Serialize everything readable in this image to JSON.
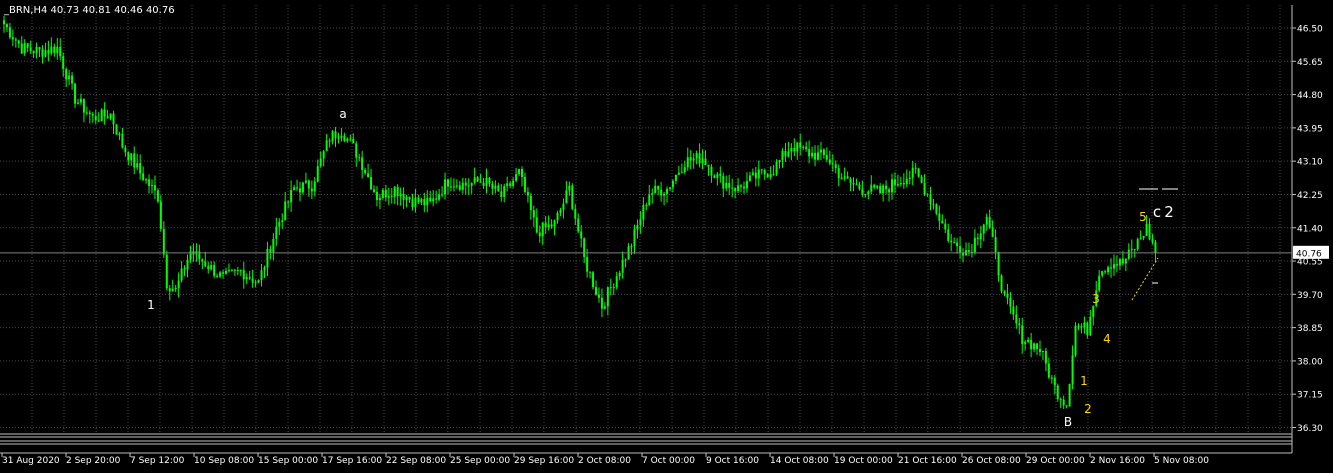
{
  "header": {
    "symbol": "_BRN,H4",
    "ohlc": "40.73 40.81 40.46 40.76"
  },
  "colors": {
    "background": "#000000",
    "grid": "#4b4b4b",
    "frame": "#c0c0c0",
    "bull": "#00ff00",
    "bear": "#00ff00",
    "text": "#ffffff",
    "wave_white": "#ffffff",
    "wave_yellow": "#ffd700",
    "price_tag_bg": "#ffffff",
    "price_tag_text": "#000000"
  },
  "chart_data": {
    "type": "candlestick",
    "timeframe": "H4",
    "ylim": [
      36.0,
      46.9
    ],
    "yticks": [
      "46.50",
      "45.65",
      "44.80",
      "43.95",
      "43.10",
      "42.25",
      "41.40",
      "40.55",
      "39.70",
      "38.85",
      "38.00",
      "37.15",
      "36.30"
    ],
    "xticks": [
      "31 Aug 2020",
      "2 Sep 20:00",
      "7 Sep 12:00",
      "10 Sep 08:00",
      "15 Sep 00:00",
      "17 Sep 16:00",
      "22 Sep 08:00",
      "25 Sep 00:00",
      "29 Sep 16:00",
      "2 Oct 08:00",
      "7 Oct 00:00",
      "9 Oct 16:00",
      "14 Oct 08:00",
      "19 Oct 00:00",
      "21 Oct 16:00",
      "26 Oct 08:00",
      "29 Oct 00:00",
      "2 Nov 16:00",
      "5 Nov 08:00"
    ],
    "current_price": "40.76",
    "close_path": [
      [
        0,
        46.6
      ],
      [
        6,
        46.0
      ],
      [
        12,
        45.9
      ],
      [
        18,
        46.0
      ],
      [
        24,
        44.7
      ],
      [
        30,
        44.2
      ],
      [
        36,
        44.3
      ],
      [
        40,
        43.5
      ],
      [
        46,
        42.8
      ],
      [
        52,
        42.2
      ],
      [
        55,
        40.0
      ],
      [
        58,
        39.8
      ],
      [
        63,
        40.8
      ],
      [
        68,
        40.5
      ],
      [
        74,
        40.1
      ],
      [
        80,
        40.3
      ],
      [
        86,
        40.0
      ],
      [
        92,
        41.4
      ],
      [
        98,
        42.4
      ],
      [
        104,
        42.5
      ],
      [
        110,
        43.7
      ],
      [
        114,
        43.9
      ],
      [
        120,
        43.2
      ],
      [
        126,
        42.2
      ],
      [
        132,
        42.4
      ],
      [
        138,
        42.1
      ],
      [
        144,
        42.0
      ],
      [
        150,
        42.6
      ],
      [
        156,
        42.5
      ],
      [
        162,
        42.6
      ],
      [
        168,
        42.2
      ],
      [
        174,
        42.8
      ],
      [
        180,
        41.3
      ],
      [
        186,
        41.5
      ],
      [
        191,
        42.4
      ],
      [
        196,
        40.6
      ],
      [
        202,
        39.4
      ],
      [
        207,
        40.2
      ],
      [
        212,
        41.0
      ],
      [
        218,
        42.3
      ],
      [
        224,
        42.4
      ],
      [
        230,
        43.1
      ],
      [
        236,
        43.2
      ],
      [
        242,
        42.6
      ],
      [
        248,
        42.4
      ],
      [
        254,
        42.7
      ],
      [
        260,
        42.9
      ],
      [
        266,
        43.5
      ],
      [
        272,
        43.3
      ],
      [
        278,
        43.2
      ],
      [
        284,
        42.6
      ],
      [
        290,
        42.4
      ],
      [
        296,
        42.3
      ],
      [
        302,
        42.6
      ],
      [
        308,
        42.8
      ],
      [
        314,
        42.0
      ],
      [
        320,
        41.0
      ],
      [
        326,
        40.8
      ],
      [
        332,
        41.7
      ],
      [
        338,
        39.6
      ],
      [
        344,
        38.6
      ],
      [
        350,
        38.3
      ],
      [
        355,
        37.3
      ],
      [
        359,
        36.9
      ],
      [
        362,
        38.9
      ],
      [
        366,
        38.8
      ],
      [
        370,
        40.3
      ],
      [
        374,
        40.5
      ],
      [
        378,
        40.5
      ],
      [
        382,
        40.9
      ],
      [
        386,
        41.4
      ],
      [
        389,
        40.8
      ]
    ],
    "wave_labels": [
      {
        "text": "1",
        "series": "white"
      },
      {
        "text": "a",
        "series": "white"
      },
      {
        "text": "B",
        "series": "white"
      },
      {
        "text": "1",
        "series": "yellow"
      },
      {
        "text": "2",
        "series": "yellow"
      },
      {
        "text": "3",
        "series": "yellow"
      },
      {
        "text": "4",
        "series": "yellow"
      },
      {
        "text": "5",
        "series": "yellow"
      },
      {
        "text": "c",
        "series": "white"
      },
      {
        "text": "2",
        "series": "white"
      }
    ]
  }
}
